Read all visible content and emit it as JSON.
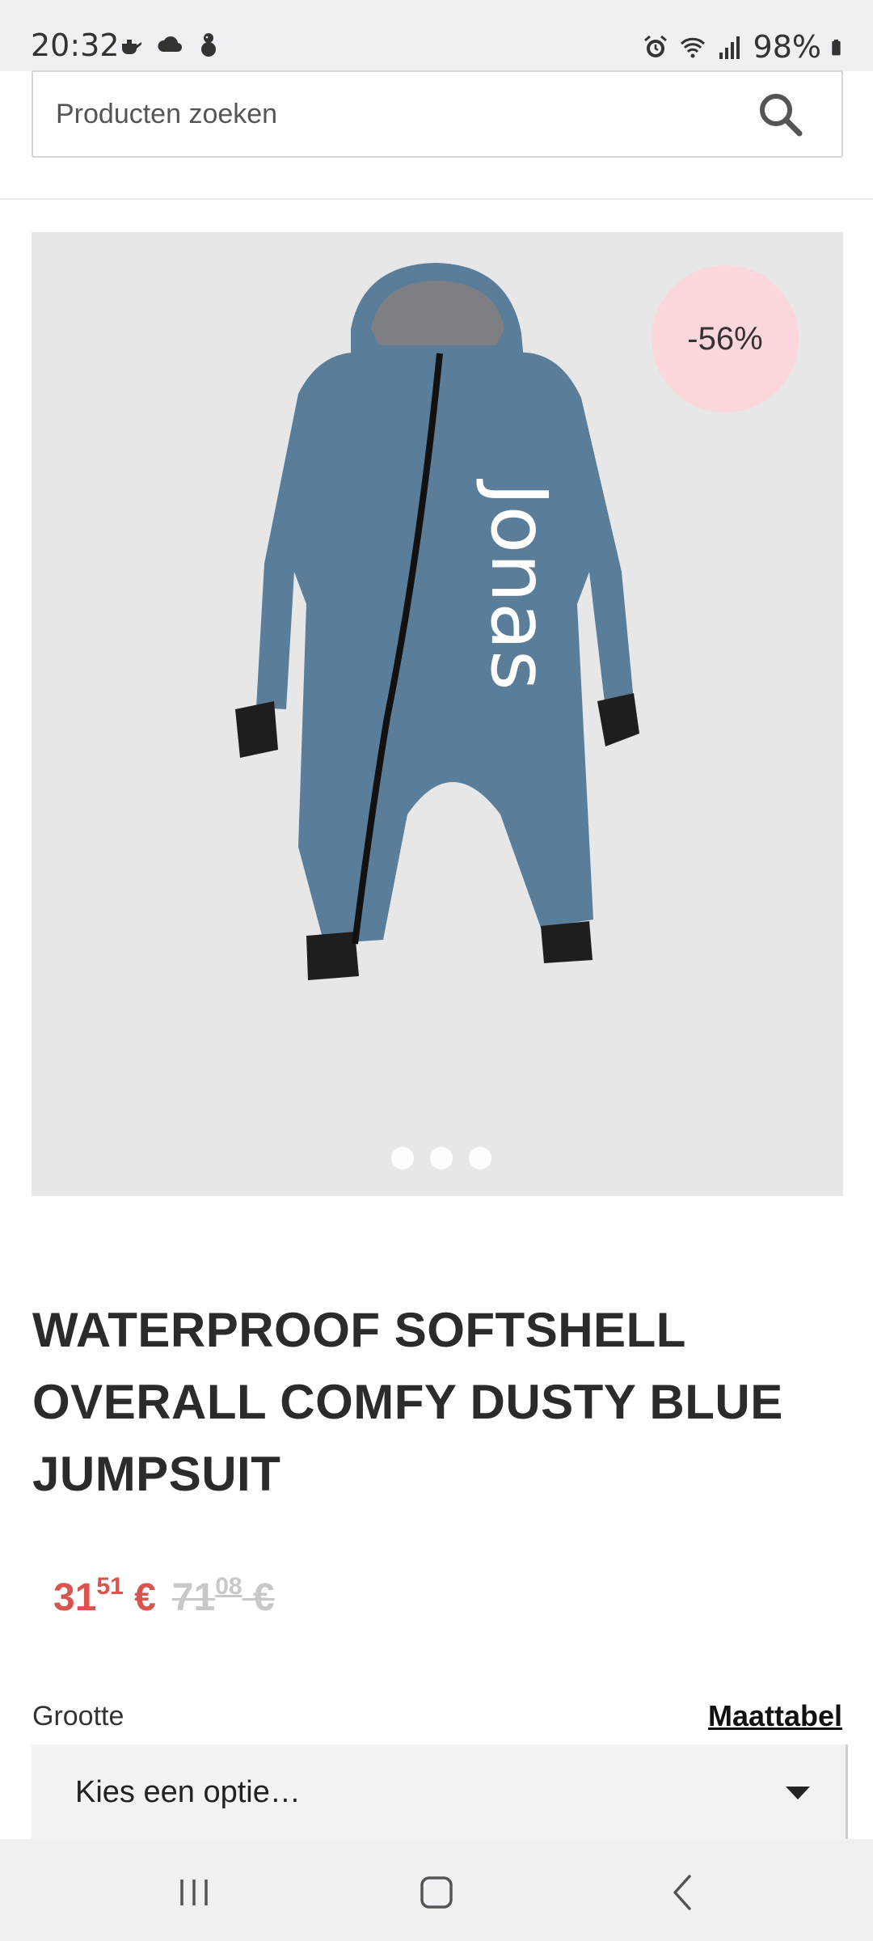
{
  "status_bar": {
    "time": "20:32",
    "battery": "98%",
    "left_icons": [
      "teapot-icon",
      "cloud-icon",
      "snowman-icon"
    ],
    "right_icons": [
      "alarm-icon",
      "wifi-icon",
      "signal-icon",
      "battery-icon"
    ]
  },
  "search": {
    "placeholder": "Producten zoeken",
    "icon": "search-icon"
  },
  "product": {
    "image_alt": "Dusty blue softshell overall with name Jonas",
    "name_on_garment": "Jonas",
    "discount_badge": "-56%",
    "carousel_dots": 3,
    "title": "WATERPROOF SOFTSHELL OVERALL COMFY DUSTY BLUE JUMPSUIT",
    "price_new_whole": "31",
    "price_new_cents": "51",
    "price_new_currency": "€",
    "price_old_whole": "71",
    "price_old_cents": "08",
    "price_old_currency": "€"
  },
  "size_selector": {
    "label": "Grootte",
    "size_chart_link": "Maattabel",
    "select_value": "Kies een optie…"
  },
  "nav_bar": {
    "buttons": [
      "recent-apps-icon",
      "home-icon",
      "back-icon"
    ]
  },
  "colors": {
    "accent_price": "#d9534f",
    "badge_bg": "#fbd6da",
    "garment": "#5a7d99"
  }
}
